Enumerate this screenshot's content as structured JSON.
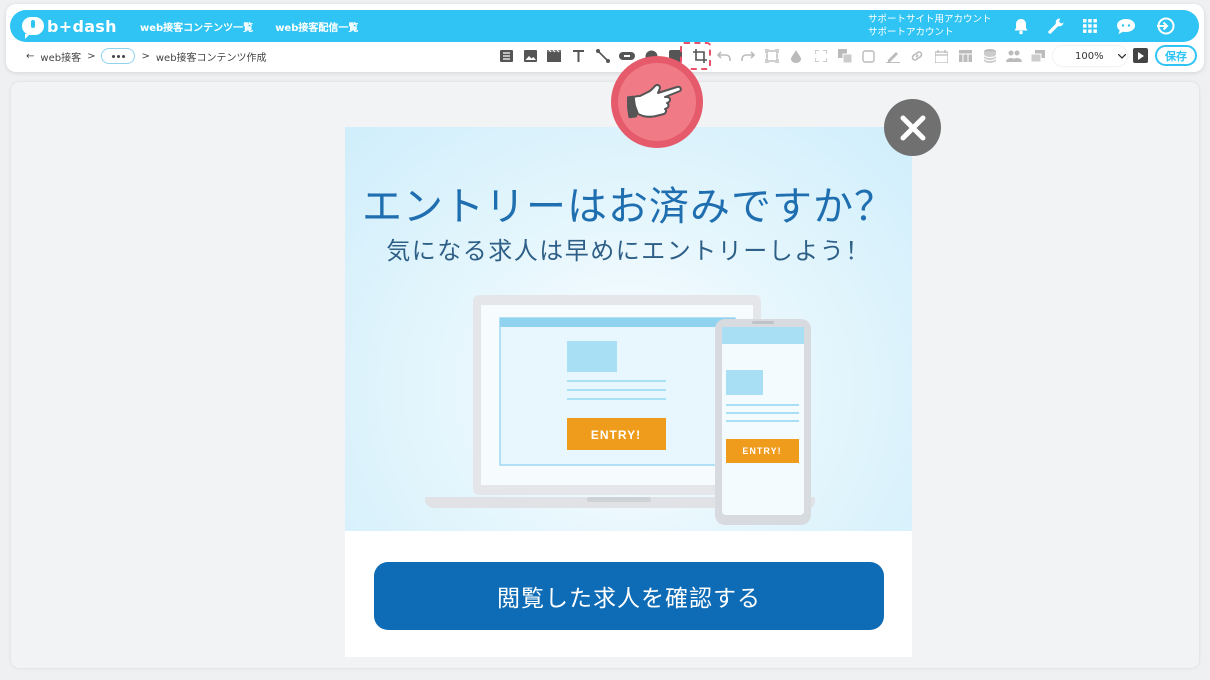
{
  "app": {
    "logo_text": "b+dash",
    "nav": [
      "web接客コンテンツ一覧",
      "web接客配信一覧"
    ],
    "account_line1": "サポートサイト用アカウント",
    "account_line2": "サポートアカウント",
    "brand_color": "#2fc4f3"
  },
  "top_icons": [
    "bell-icon",
    "wrench-icon",
    "apps-grid-icon",
    "chat-bot-icon",
    "logout-icon"
  ],
  "breadcrumb": {
    "back_arrow": "←",
    "item1": "web接客",
    "sep": ">",
    "item3": "web接客コンテンツ作成"
  },
  "toolbar": {
    "tools": [
      "list-icon",
      "image-icon",
      "video-icon",
      "text-icon",
      "line-icon",
      "button-icon",
      "badge-icon",
      "number-icon",
      "crop-icon",
      "undo-icon",
      "redo-icon",
      "frame-icon",
      "fill-icon",
      "fullscreen-icon",
      "layer-icon",
      "border-icon",
      "pen-icon",
      "link-icon",
      "calendar-icon",
      "table-icon",
      "database-icon",
      "users-icon",
      "copy-icon"
    ],
    "zoom": "100%",
    "save_label": "保存",
    "highlight_color": "#e8536b"
  },
  "popup": {
    "title": "エントリーはお済みですか？",
    "subtitle": "気になる求人は早めにエントリーしよう！",
    "laptop_button": "ENTRY!",
    "phone_button": "ENTRY!",
    "cta_label": "閲覧した求人を確認する",
    "cta_color": "#0e6bb5"
  }
}
